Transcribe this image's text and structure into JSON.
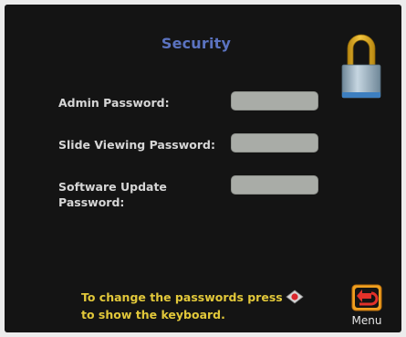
{
  "screen": {
    "title": "Security"
  },
  "fields": [
    {
      "label": "Admin Password:",
      "value": ""
    },
    {
      "label": "Slide Viewing Password:",
      "value": ""
    },
    {
      "label": "Software Update Password:",
      "value": ""
    }
  ],
  "hint": {
    "line1": "To change the passwords press",
    "line2": "to show the keyboard."
  },
  "menu": {
    "label": "Menu"
  },
  "colors": {
    "background": "#141414",
    "title": "#5b73c0",
    "label": "#d6d6d6",
    "field": "#a9aca7",
    "hint": "#e2c83a",
    "lock_shackle": "#e8b530",
    "lock_body": "#98b3c6"
  },
  "icons": {
    "lock": "padlock-icon",
    "dpad": "dpad-select-icon",
    "menu": "return-arrow-icon"
  }
}
